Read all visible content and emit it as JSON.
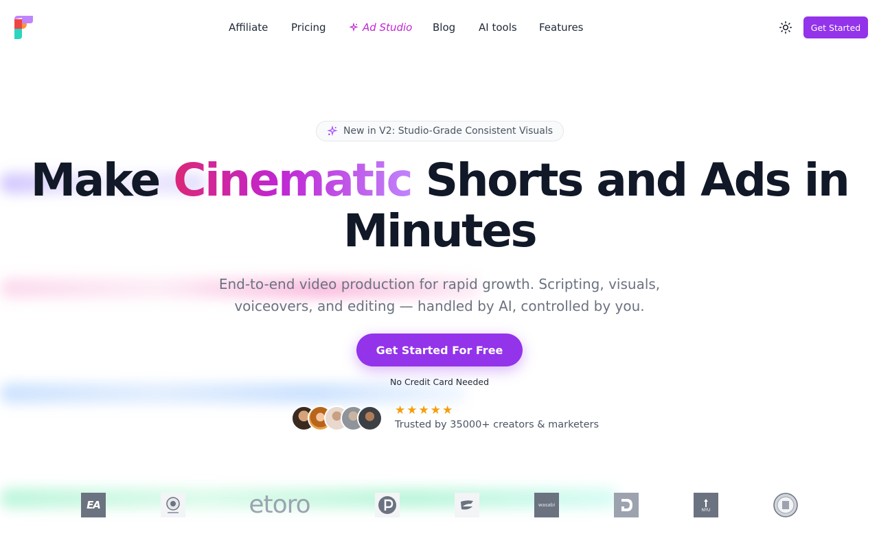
{
  "nav": {
    "items": [
      {
        "label": "Affiliate"
      },
      {
        "label": "Pricing"
      },
      {
        "label": "Ad Studio"
      },
      {
        "label": "Blog"
      },
      {
        "label": "AI tools"
      },
      {
        "label": "Features"
      }
    ],
    "cta_label": "Get Started",
    "theme_icon": "sun-icon"
  },
  "hero": {
    "badge": "New in V2: Studio-Grade Consistent Visuals",
    "headline_before": "Make ",
    "headline_highlight": "Cinematic",
    "headline_after": " Shorts and Ads in Minutes",
    "subtitle": "End-to-end video production for rapid growth. Scripting, visuals, voiceovers, and editing — handled by AI, controlled by you.",
    "cta_label": "Get Started For Free",
    "cta_note": "No Credit Card Needed"
  },
  "social_proof": {
    "stars": 5,
    "text": "Trusted by 35000+ creators & marketers"
  },
  "logos": {
    "wordmark": "etoro",
    "nyu": "NYU",
    "ea": "EA",
    "wasabi": "wasabi"
  },
  "colors": {
    "brand": "#9333ea",
    "accent_pink": "#db2777",
    "star": "#f59e0b",
    "text_dark": "#111827"
  }
}
